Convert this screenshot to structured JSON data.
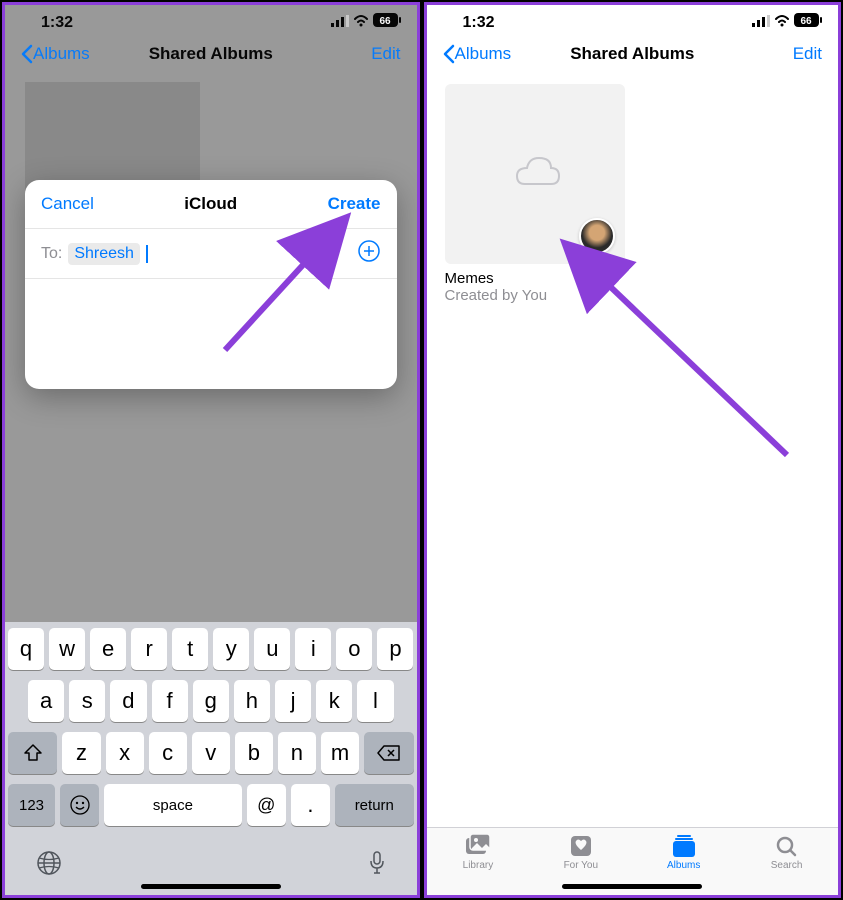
{
  "status": {
    "time": "1:32",
    "battery": "66"
  },
  "nav": {
    "back": "Albums",
    "title": "Shared Albums",
    "edit": "Edit"
  },
  "modal": {
    "cancel": "Cancel",
    "title": "iCloud",
    "create": "Create",
    "to_label": "To:",
    "recipient": "Shreesh"
  },
  "keyboard": {
    "row1": [
      "q",
      "w",
      "e",
      "r",
      "t",
      "y",
      "u",
      "i",
      "o",
      "p"
    ],
    "row2": [
      "a",
      "s",
      "d",
      "f",
      "g",
      "h",
      "j",
      "k",
      "l"
    ],
    "row3": [
      "z",
      "x",
      "c",
      "v",
      "b",
      "n",
      "m"
    ],
    "num": "123",
    "space": "space",
    "at": "@",
    "dot": ".",
    "return": "return"
  },
  "album": {
    "name": "Memes",
    "subtitle": "Created by You"
  },
  "tabs": {
    "library": "Library",
    "foryou": "For You",
    "albums": "Albums",
    "search": "Search"
  }
}
